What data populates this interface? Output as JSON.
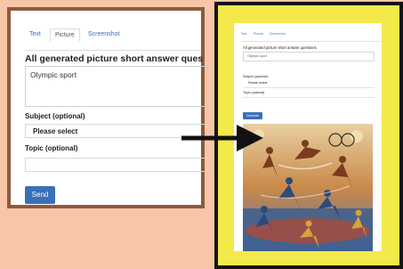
{
  "left_panel": {
    "tabs": [
      {
        "label": "Text",
        "active": false
      },
      {
        "label": "Picture",
        "active": true
      },
      {
        "label": "Screenshot",
        "active": false
      }
    ],
    "title": "All generated picture short answer questio",
    "textarea_value": "Olympic sport",
    "subject_label": "Subject (optional)",
    "subject_select_value": "Please select",
    "topic_label": "Topic (optional)",
    "topic_value": "",
    "send_label": "Send"
  },
  "right_panel": {
    "tabs": [
      {
        "label": "Text",
        "active": false
      },
      {
        "label": "Picture",
        "active": true
      },
      {
        "label": "Screenshot",
        "active": false
      }
    ],
    "title": "All generated picture short answer questions",
    "input_value": "Olympic sport",
    "subject_label": "Subject (optional)",
    "subject_value": "Please select",
    "topic_label": "Topic (optional)",
    "send_label": "Generate"
  },
  "colors": {
    "background": "#f6c6a6",
    "left_border": "#8c5a3e",
    "right_frame": "#141414",
    "right_highlight": "#f4e94a",
    "accent": "#3a70b7"
  },
  "icons": {
    "arrow": "arrow-right-icon"
  }
}
